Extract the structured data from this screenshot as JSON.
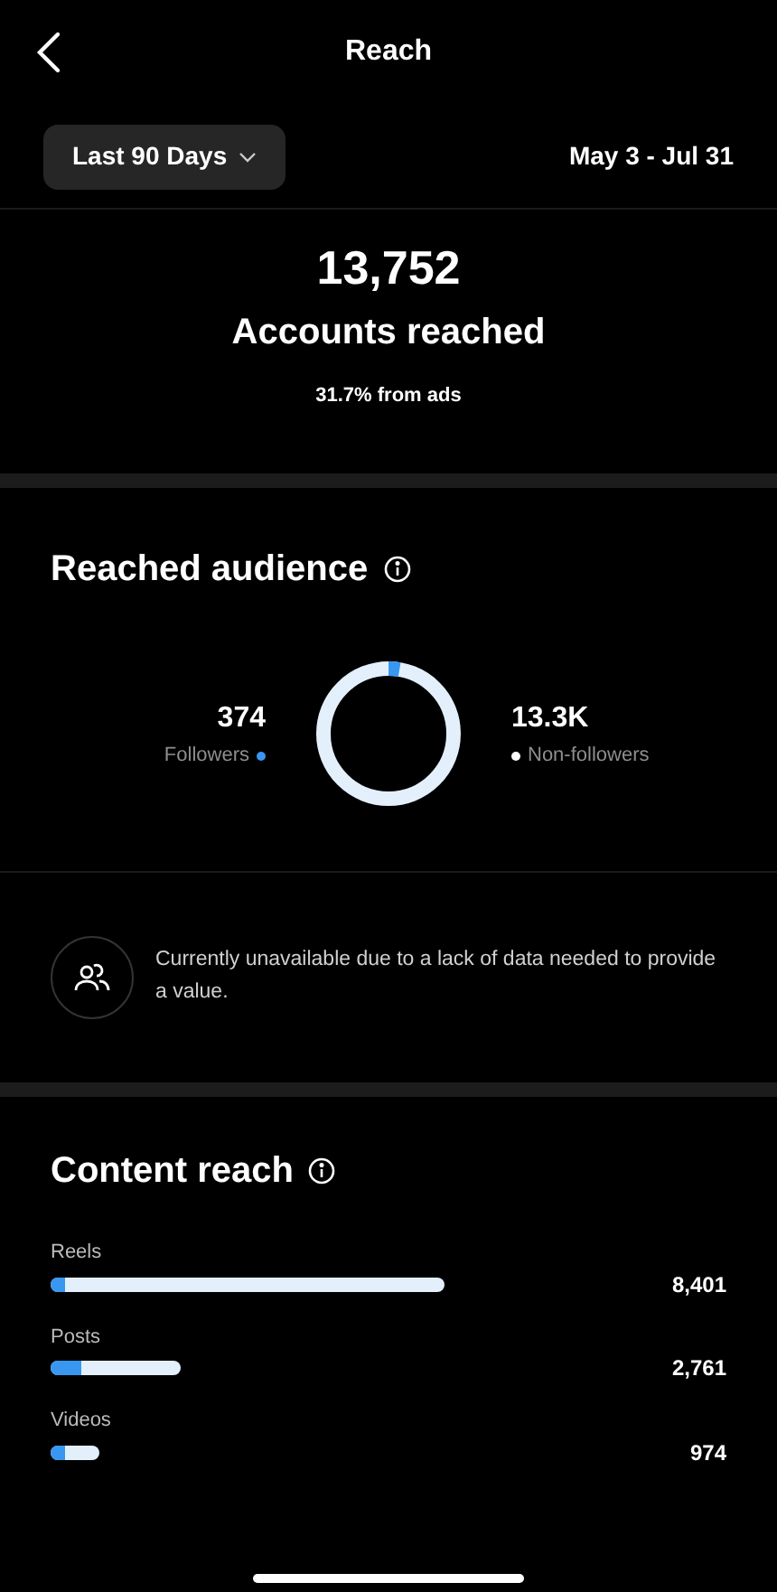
{
  "header": {
    "title": "Reach"
  },
  "filter": {
    "range": "Last 90 Days",
    "dates": "May 3 - Jul 31"
  },
  "summary": {
    "value": "13,752",
    "label": "Accounts reached",
    "note": "31.7% from ads"
  },
  "audience": {
    "title": "Reached audience",
    "groups": [
      {
        "value": "374",
        "label": "Followers",
        "color": "#3897f0"
      },
      {
        "value": "13.3K",
        "label": "Non-followers",
        "color": "#ffffff"
      }
    ],
    "notice": "Currently unavailable due to a lack of data needed to provide a value."
  },
  "content": {
    "title": "Content reach",
    "rows": [
      {
        "label": "Reels",
        "value": "8,401"
      },
      {
        "label": "Posts",
        "value": "2,761"
      },
      {
        "label": "Videos",
        "value": "974"
      }
    ]
  }
}
